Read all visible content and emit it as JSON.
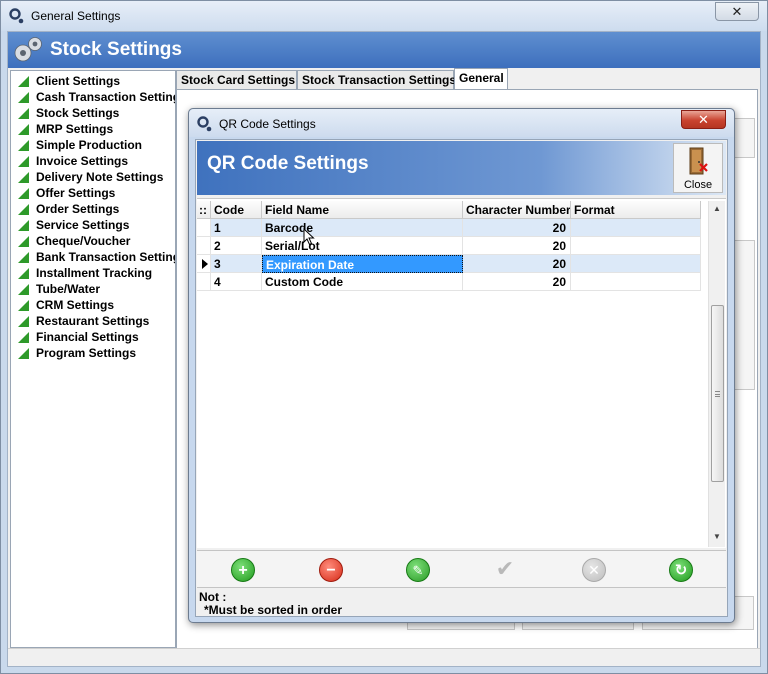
{
  "window": {
    "title": "General Settings",
    "close_glyph": "✕"
  },
  "header": {
    "title": "Stock Settings"
  },
  "nav": {
    "items": [
      "Client Settings",
      "Cash Transaction Settings",
      "Stock Settings",
      "MRP Settings",
      "Simple Production",
      "Invoice Settings",
      "Delivery Note Settings",
      "Offer Settings",
      "Order Settings",
      "Service Settings",
      "Cheque/Voucher",
      "Bank Transaction Settings",
      "Installment Tracking",
      "Tube/Water",
      "CRM Settings",
      "Restaurant Settings",
      "Financial Settings",
      "Program Settings"
    ],
    "icon": "green-triangle-icon"
  },
  "tabs": [
    {
      "label": "Stock Card Settings",
      "active": false
    },
    {
      "label": "Stock Transaction Settings",
      "active": false
    },
    {
      "label": "General",
      "active": true
    }
  ],
  "dialog": {
    "title": "QR Code Settings",
    "header_title": "QR Code Settings",
    "close_label": "Close",
    "close_glyph": "✕",
    "grid": {
      "row_header_glyph": "::",
      "columns": [
        "Code",
        "Field Name",
        "Character Number",
        "Format"
      ],
      "rows": [
        {
          "code": "1",
          "field": "Barcode",
          "chars": "20",
          "format": ""
        },
        {
          "code": "2",
          "field": "Serial/Lot",
          "chars": "20",
          "format": ""
        },
        {
          "code": "3",
          "field": "Expiration Date",
          "chars": "20",
          "format": ""
        },
        {
          "code": "4",
          "field": "Custom Code",
          "chars": "20",
          "format": ""
        }
      ],
      "selected_row": 3
    },
    "toolbar": [
      "add-icon",
      "delete-icon",
      "edit-icon",
      "confirm-icon",
      "cancel-icon",
      "refresh-icon"
    ],
    "note_label": "Not :",
    "note_text": "*Must be sorted in order"
  },
  "colors": {
    "header_blue": "#3d6fbd",
    "selection": "#3399ff",
    "alt_row": "#dce9f8",
    "nav_icon": "#2e9a2a"
  }
}
